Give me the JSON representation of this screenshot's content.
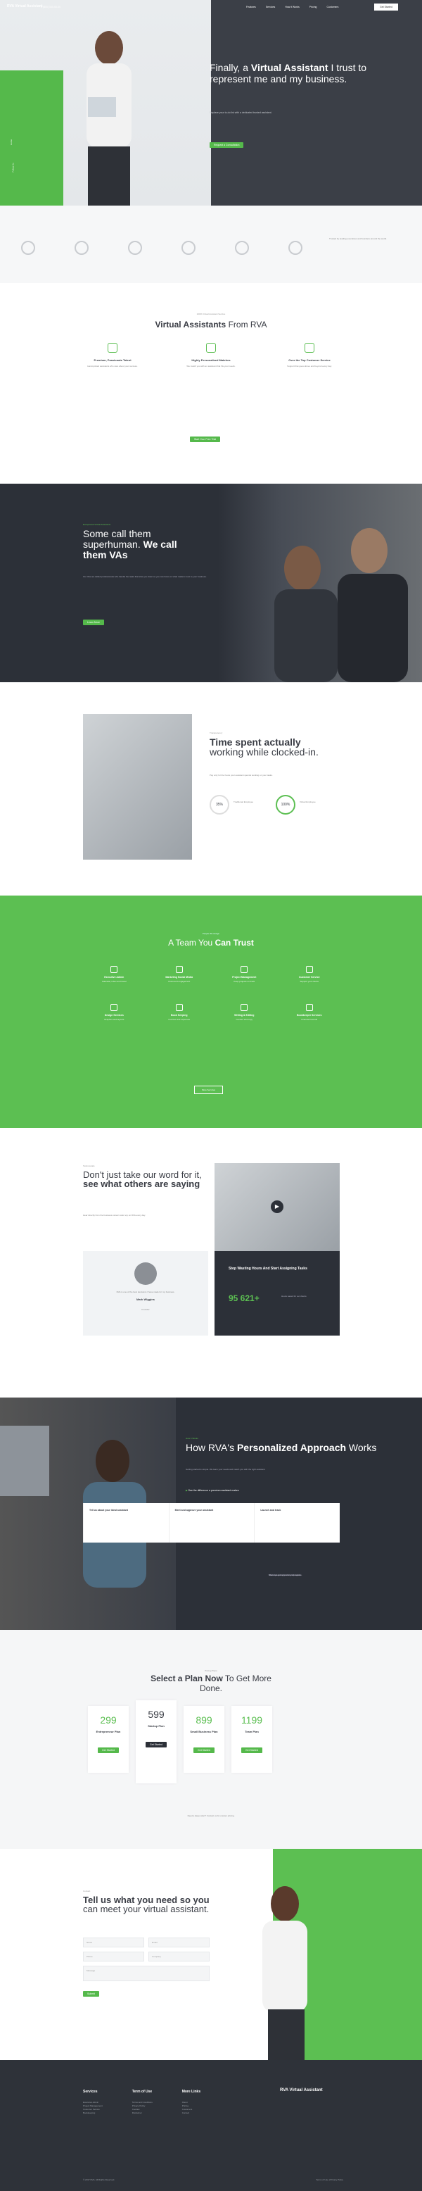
{
  "nav": {
    "logo": "RVA Virtual Assistant",
    "phone": "1 (800) 000-00-00",
    "items": [
      "Features",
      "Services",
      "How it Works",
      "Pricing",
      "Customers"
    ],
    "cta": "Get Started"
  },
  "hero": {
    "title_pre": "Finally, a ",
    "title_bold": "Virtual Assistant",
    "title_post": " I trust to represent me and my business.",
    "subtitle": "Replace your to-do list with a dedicated trusted assistant.",
    "button": "Request a Consultation",
    "side1": "Home",
    "side2": "Follow Us"
  },
  "logos": {
    "text": "Trusted by leading executives and founders around the world."
  },
  "vas": {
    "over": "100% Virtual Assistant Service",
    "title_bold": "Virtual Assistants",
    "title_rest": " From RVA",
    "cols": [
      {
        "title": "Premium, Passionate Talent",
        "text": "Hand-picked assistants who care about your success."
      },
      {
        "title": "Highly Personalized Matches",
        "text": "We match you with an assistant that fits your needs."
      },
      {
        "title": "Over the Top Customer Service",
        "text": "Support that goes above and beyond every day."
      }
    ],
    "button": "Start Your Free Trial"
  },
  "super": {
    "over": "Exceptional Virtual Assistants",
    "title_pre": "Some call them superhuman. ",
    "title_bold": "We call them VAs",
    "text": "Our VAs are skilled professionals who handle the tasks that slow you down so you can focus on what matters most to your business.",
    "button": "Learn More"
  },
  "time": {
    "over": "Transparency",
    "title_bold": "Time spent actually",
    "title_rest": " working while clocked-in.",
    "text": "Pay only for the hours your assistant spends working on your tasks.",
    "r1": "35%",
    "r1l": "Traditional Employee",
    "r2": "100%",
    "r2l": "Virtual Employee"
  },
  "team": {
    "over": "People We Assign",
    "title_pre": "A Team You ",
    "title_bold": "Can Trust",
    "items": [
      {
        "title": "Executive Admin",
        "text": "Calendar, inbox and travel"
      },
      {
        "title": "Marketing Social Media",
        "text": "Posts and engagement"
      },
      {
        "title": "Project Management",
        "text": "Keep projects on track"
      },
      {
        "title": "Customer Service",
        "text": "Support your clients"
      },
      {
        "title": "Design Services",
        "text": "Graphics and layouts"
      },
      {
        "title": "Book Keeping",
        "text": "Invoices and expenses"
      },
      {
        "title": "Writing & Editing",
        "text": "Content and copy"
      },
      {
        "title": "Bookkeeper Services",
        "text": "Financial records"
      }
    ],
    "button": "More Services"
  },
  "test": {
    "over": "Testimonials",
    "title_pre": "Don't just take our word for it, ",
    "title_bold": "see what others are saying",
    "lead": "Hear directly from the business owners who rely on RVA every day.",
    "quote": "RVA is one of the best decisions I have made for my business.",
    "author": "Mark Wiggins",
    "role": "Founder",
    "dark_title": "Stop Wasting Hours And Start Assigning Tasks",
    "stat": "95 621+",
    "stat_label": "Hours saved for our clients"
  },
  "proc": {
    "over": "How It Works",
    "title_pre": "How RVA's ",
    "title_bold": "Personalized Approach",
    "title_post": " Works",
    "text": "Getting started is simple. We learn your needs and match you with the right assistant.",
    "play": "See the difference a premium assistant makes",
    "steps": [
      {
        "title": "Tell us about your ideal assistant",
        "text": "Share your needs and preferences."
      },
      {
        "title": "Meet and approve your assistant",
        "text": "Interview and approve your match."
      },
      {
        "title": "Launch and track",
        "text": "Start delegating and track progress."
      }
    ]
  },
  "price": {
    "over": "Pricing Plans",
    "title_bold": "Select a Plan Now",
    "title_rest": " To Get More Done.",
    "plans": [
      {
        "amt": "299",
        "name": "Entrepreneur Plan",
        "btn": "Get Started"
      },
      {
        "amt": "599",
        "name": "Startup Plan",
        "btn": "Get Started"
      },
      {
        "amt": "899",
        "name": "Small Business Plan",
        "btn": "Get Started"
      },
      {
        "amt": "1199",
        "name": "Team Plan",
        "btn": "Get Started"
      }
    ],
    "note": "Need a larger plan? Contact us for custom pricing."
  },
  "contact": {
    "over": "Contact",
    "title_bold": "Tell us what you need so you",
    "title_rest": " can meet your virtual assistant.",
    "f1": "Name",
    "f2": "Email",
    "f3": "Phone",
    "f4": "Company",
    "f5": "Message",
    "button": "Submit"
  },
  "foot": {
    "cols": [
      {
        "title": "Services",
        "items": [
          "Executive Admin",
          "Project Management",
          "Customer Service",
          "Bookkeeping"
        ]
      },
      {
        "title": "Term of Use",
        "items": [
          "Terms and Conditions",
          "Privacy Policy",
          "Cookies",
          "Disclaimer"
        ]
      },
      {
        "title": "More Links",
        "items": [
          "About",
          "Pricing",
          "Customers",
          "Contact"
        ]
      }
    ],
    "logo": "RVA Virtual Assistant",
    "copyright": "© 2017 RVA. All Rights Reserved.",
    "bottom": "Terms of Use | Privacy Policy"
  }
}
